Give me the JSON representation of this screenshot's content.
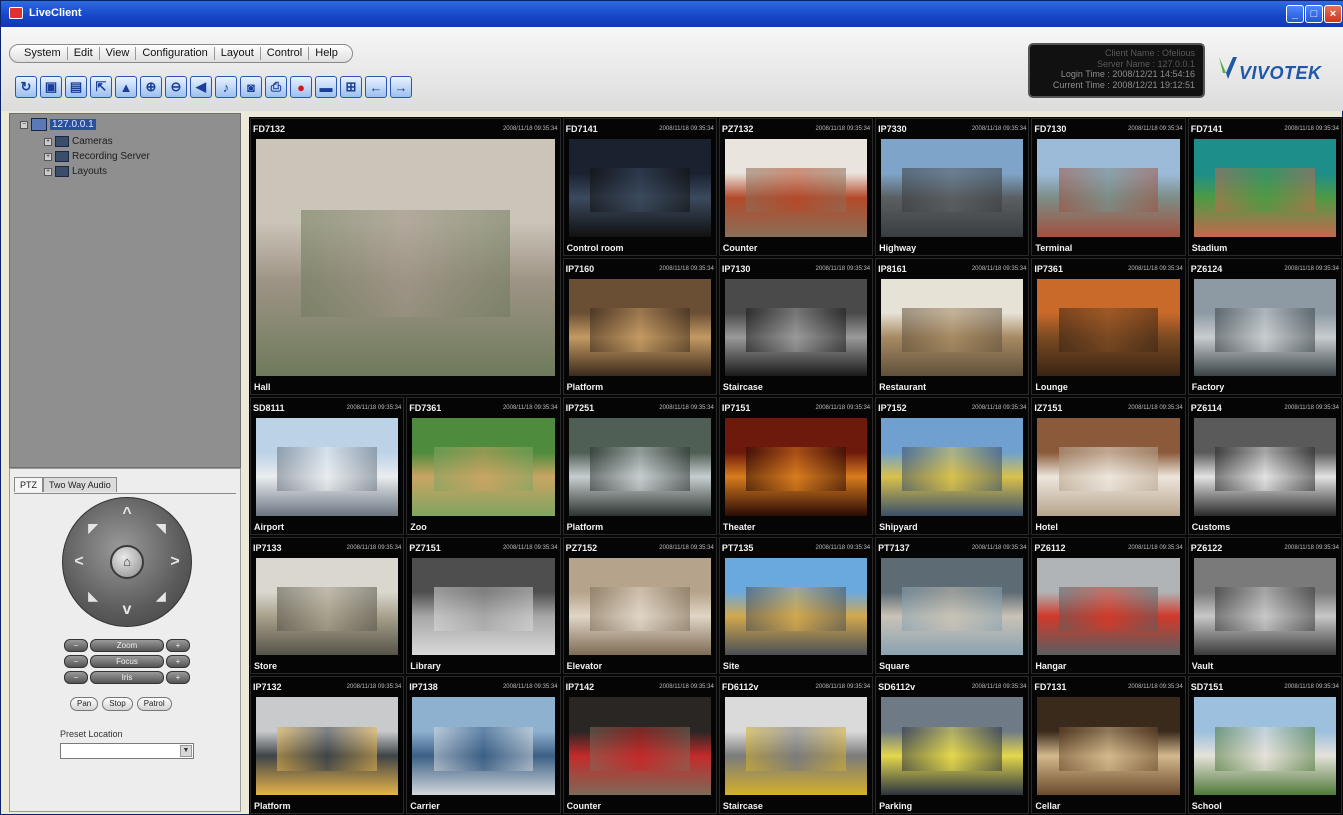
{
  "window": {
    "title": "LiveClient"
  },
  "menu": [
    "System",
    "Edit",
    "View",
    "Configuration",
    "Layout",
    "Control",
    "Help"
  ],
  "toolbar": [
    {
      "name": "refresh-icon",
      "glyph": "↻"
    },
    {
      "name": "window-icon",
      "glyph": "▣"
    },
    {
      "name": "windows-icon",
      "glyph": "▤"
    },
    {
      "name": "export-icon",
      "glyph": "⇱"
    },
    {
      "name": "lock-icon",
      "glyph": "▲"
    },
    {
      "name": "zoom-in-icon",
      "glyph": "⊕"
    },
    {
      "name": "zoom-out-icon",
      "glyph": "⊖"
    },
    {
      "name": "speaker-icon",
      "glyph": "◀"
    },
    {
      "name": "microphone-icon",
      "glyph": "♪"
    },
    {
      "name": "snapshot-icon",
      "glyph": "◙"
    },
    {
      "name": "print-icon",
      "glyph": "⎙"
    },
    {
      "name": "record-icon",
      "glyph": "●"
    },
    {
      "name": "folder-icon",
      "glyph": "▬"
    },
    {
      "name": "layout-grid-icon",
      "glyph": "⊞"
    },
    {
      "name": "back-arrow-icon",
      "glyph": "←"
    },
    {
      "name": "forward-arrow-icon",
      "glyph": "→"
    }
  ],
  "server_info": {
    "line1": "Client Name : Ofelious",
    "line2": "Server Name : 127.0.0.1",
    "line3": "Login Time : 2008/12/21 14:54:16",
    "line4": "Current Time : 2008/12/21 19:12:51"
  },
  "logo": {
    "text": "VIVOTEK"
  },
  "tree": {
    "root": "127.0.0.1",
    "children": [
      "Cameras",
      "Recording Server",
      "Layouts"
    ]
  },
  "ptz": {
    "tabs": [
      "PTZ",
      "Two Way Audio"
    ],
    "rows": [
      "Zoom",
      "Focus",
      "Iris"
    ],
    "buttons": [
      "Pan",
      "Stop",
      "Patrol"
    ],
    "preset_label": "Preset Location",
    "preset_value": ""
  },
  "timestamp": "2008/11/18 09:35:34",
  "cameras": [
    {
      "model": "FD7132",
      "caption": "Hall",
      "scene": "hall"
    },
    {
      "model": "FD7141",
      "caption": "Control room",
      "scene": "control"
    },
    {
      "model": "PZ7132",
      "caption": "Counter",
      "scene": "counter"
    },
    {
      "model": "IP7330",
      "caption": "Highway",
      "scene": "highway"
    },
    {
      "model": "FD7130",
      "caption": "Terminal",
      "scene": "terminal"
    },
    {
      "model": "FD7141",
      "caption": "Stadium",
      "scene": "stadium"
    },
    {
      "model": "IP7160",
      "caption": "Platform",
      "scene": "platform1"
    },
    {
      "model": "IP7130",
      "caption": "Staircase",
      "scene": "staircase1"
    },
    {
      "model": "IP8161",
      "caption": "Restaurant",
      "scene": "restaurant"
    },
    {
      "model": "IP7361",
      "caption": "Lounge",
      "scene": "lounge"
    },
    {
      "model": "PZ6124",
      "caption": "Factory",
      "scene": "factory"
    },
    {
      "model": "SD8111",
      "caption": "Airport",
      "scene": "airport"
    },
    {
      "model": "FD7361",
      "caption": "Zoo",
      "scene": "zoo"
    },
    {
      "model": "IP7251",
      "caption": "Platform",
      "scene": "platform2"
    },
    {
      "model": "IP7151",
      "caption": "Theater",
      "scene": "theater"
    },
    {
      "model": "IP7152",
      "caption": "Shipyard",
      "scene": "shipyard"
    },
    {
      "model": "IZ7151",
      "caption": "Hotel",
      "scene": "hotel"
    },
    {
      "model": "PZ6114",
      "caption": "Customs",
      "scene": "customs"
    },
    {
      "model": "IP7133",
      "caption": "Store",
      "scene": "store"
    },
    {
      "model": "PZ7151",
      "caption": "Library",
      "scene": "library"
    },
    {
      "model": "PZ7152",
      "caption": "Elevator",
      "scene": "elevator"
    },
    {
      "model": "PT7135",
      "caption": "Site",
      "scene": "site"
    },
    {
      "model": "PT7137",
      "caption": "Square",
      "scene": "square"
    },
    {
      "model": "PZ6112",
      "caption": "Hangar",
      "scene": "hangar"
    },
    {
      "model": "PZ6122",
      "caption": "Vault",
      "scene": "vault"
    },
    {
      "model": "IP7132",
      "caption": "Platform",
      "scene": "platform3"
    },
    {
      "model": "IP7138",
      "caption": "Carrier",
      "scene": "carrier"
    },
    {
      "model": "IP7142",
      "caption": "Counter",
      "scene": "counter2"
    },
    {
      "model": "FD6112v",
      "caption": "Staircase",
      "scene": "staircase2"
    },
    {
      "model": "SD6112v",
      "caption": "Parking",
      "scene": "parking"
    },
    {
      "model": "FD7131",
      "caption": "Cellar",
      "scene": "cellar"
    },
    {
      "model": "SD7151",
      "caption": "School",
      "scene": "school"
    }
  ]
}
